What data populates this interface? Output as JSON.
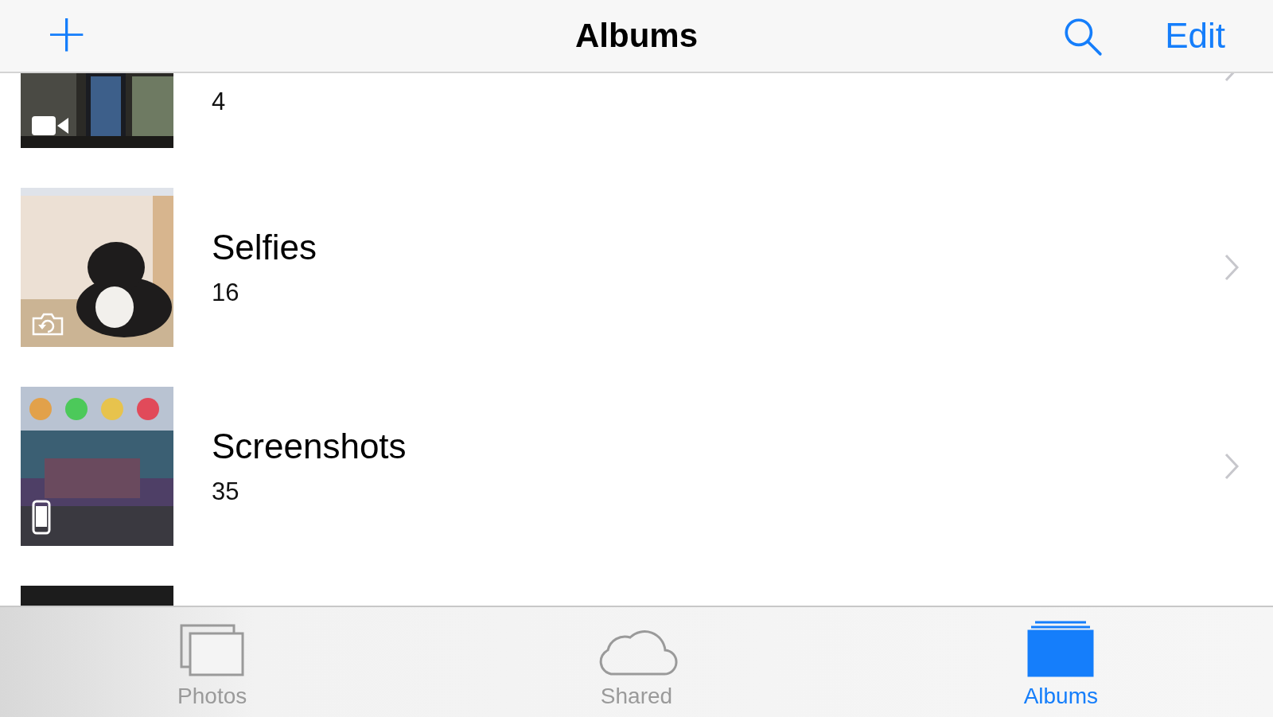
{
  "nav_bar": {
    "add_button": "+",
    "title": "Albums",
    "edit_button": "Edit"
  },
  "albums": [
    {
      "count": "4",
      "kind": "video"
    },
    {
      "name": "Selfies",
      "count": "16",
      "kind": "selfie"
    },
    {
      "name": "Screenshots",
      "count": "35",
      "kind": "screenshot"
    },
    {
      "kind": "picture"
    }
  ],
  "tabs": [
    {
      "label": "Photos",
      "selected": false
    },
    {
      "label": "Shared",
      "selected": false
    },
    {
      "label": "Albums",
      "selected": true
    }
  ]
}
